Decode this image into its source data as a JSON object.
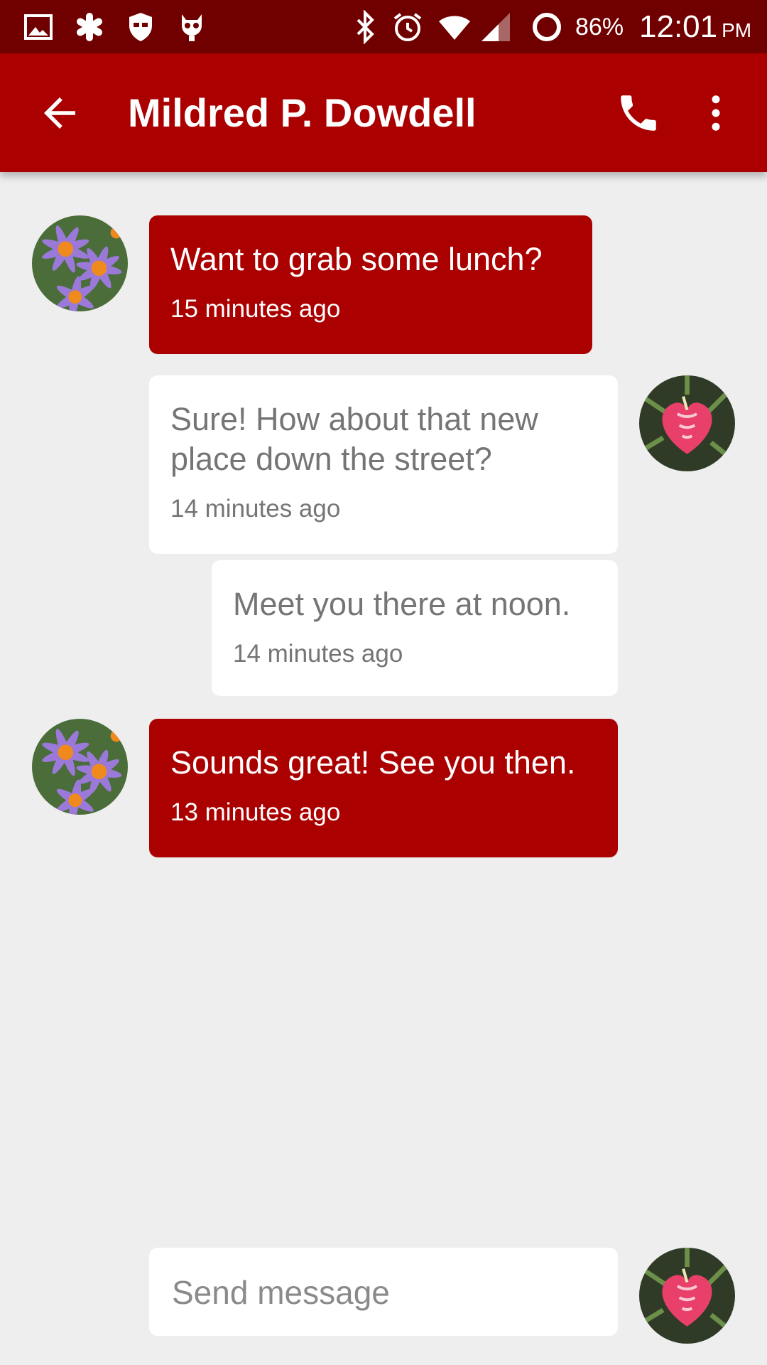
{
  "status_bar": {
    "notification_icons": [
      "image-icon",
      "asterisk-icon",
      "shield-icon",
      "robot-icon"
    ],
    "system_icons": [
      "bluetooth-icon",
      "alarm-icon",
      "wifi-icon",
      "cell-signal-icon",
      "battery-ring-icon"
    ],
    "battery_percent": "86%",
    "time": "12:01",
    "ampm": "PM"
  },
  "app_bar": {
    "title": "Mildred P. Dowdell",
    "back_icon": "arrow-back-icon",
    "call_icon": "phone-icon",
    "more_icon": "more-vert-icon"
  },
  "colors": {
    "status_bar": "#700000",
    "app_bar": "#aa0000",
    "incoming_bubble": "#aa0000",
    "outgoing_bubble": "#ffffff",
    "background": "#eeeeee"
  },
  "messages": [
    {
      "sender": "contact",
      "text": "Want to grab some lunch?",
      "time": "15 minutes ago"
    },
    {
      "sender": "me",
      "text": "Sure! How about that new place down the street?",
      "time": "14 minutes ago"
    },
    {
      "sender": "me",
      "text": "Meet you there at noon.",
      "time": "14 minutes ago"
    },
    {
      "sender": "contact",
      "text": "Sounds great! See you then.",
      "time": "13 minutes ago"
    }
  ],
  "composer": {
    "placeholder": "Send message"
  }
}
